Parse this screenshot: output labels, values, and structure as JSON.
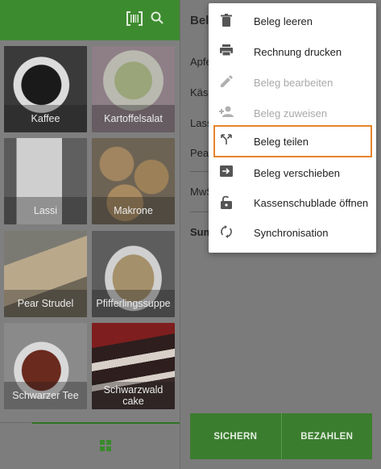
{
  "left_panel": {
    "products": [
      {
        "label": "Kaffee",
        "color": "#2b2b2b"
      },
      {
        "label": "Kartoffelsalat",
        "color": "#8a8a7a"
      },
      {
        "label": "Lassi",
        "color": "#6c6c6c"
      },
      {
        "label": "Makrone",
        "color": "#7b6e5b"
      },
      {
        "label": "Pear Strudel",
        "color": "#7a7060"
      },
      {
        "label": "Pfifferlingssuppe",
        "color": "#7a6b4e"
      },
      {
        "label": "Schwarzer Tee",
        "color": "#6b4a3a"
      },
      {
        "label": "Schwarzwald cake",
        "color": "#4a3535"
      }
    ]
  },
  "right_panel": {
    "header": "Bele",
    "rows": [
      "Apfe",
      "Käse",
      "Lass",
      "Pear"
    ],
    "mwst": "MwS",
    "sum": "Sum",
    "buttons": {
      "save": "SICHERN",
      "pay": "BEZAHLEN"
    }
  },
  "menu": {
    "items": [
      {
        "label": "Beleg leeren",
        "icon": "trash-icon",
        "glyph": "🗑",
        "disabled": false
      },
      {
        "label": "Rechnung drucken",
        "icon": "printer-icon",
        "glyph": "⎙",
        "disabled": false
      },
      {
        "label": "Beleg bearbeiten",
        "icon": "pencil-icon",
        "glyph": "✎",
        "disabled": true
      },
      {
        "label": "Beleg zuweisen",
        "icon": "assign-person-icon",
        "glyph": "⇢",
        "disabled": true
      },
      {
        "label": "Beleg teilen",
        "icon": "split-icon",
        "glyph": "⤱",
        "disabled": false
      },
      {
        "label": "Beleg verschieben",
        "icon": "move-icon",
        "glyph": "➜",
        "disabled": false
      },
      {
        "label": "Kassenschublade öffnen",
        "icon": "unlock-icon",
        "glyph": "🔓",
        "disabled": false
      },
      {
        "label": "Synchronisation",
        "icon": "sync-icon",
        "glyph": "⟳",
        "disabled": false
      }
    ],
    "highlight_color": "#e8832a"
  }
}
